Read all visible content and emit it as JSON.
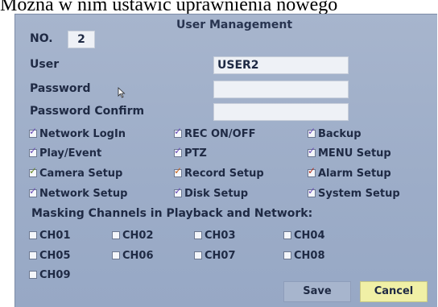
{
  "caption": "Można w nim ustawić uprawnienia nowego",
  "dialog": {
    "title": "User Management",
    "no_label": "NO.",
    "no_value": "2",
    "user_label": "User",
    "user_value": "USER2",
    "password_label": "Password",
    "password_value": "",
    "confirm_label": "Password Confirm",
    "confirm_value": ""
  },
  "permissions": [
    {
      "label": "Network LogIn",
      "checked": true,
      "color": "#6a4bb8"
    },
    {
      "label": "REC ON/OFF",
      "checked": true,
      "color": "#6a4bb8"
    },
    {
      "label": "Backup",
      "checked": true,
      "color": "#6a4bb8"
    },
    {
      "label": "Play/Event",
      "checked": true,
      "color": "#6a4bb8"
    },
    {
      "label": "PTZ",
      "checked": true,
      "color": "#6a4bb8"
    },
    {
      "label": "MENU Setup",
      "checked": true,
      "color": "#6a4bb8"
    },
    {
      "label": "Camera Setup",
      "checked": true,
      "color": "#6a8a25"
    },
    {
      "label": "Record Setup",
      "checked": true,
      "color": "#c8641c"
    },
    {
      "label": "Alarm Setup",
      "checked": true,
      "color": "#b6321e"
    },
    {
      "label": "Network Setup",
      "checked": true,
      "color": "#6a4bb8"
    },
    {
      "label": "Disk Setup",
      "checked": true,
      "color": "#6a4bb8"
    },
    {
      "label": "System Setup",
      "checked": true,
      "color": "#6a4bb8"
    }
  ],
  "masking_label": "Masking Channels in Playback and Network:",
  "channels": [
    {
      "label": "CH01",
      "checked": false
    },
    {
      "label": "CH02",
      "checked": false
    },
    {
      "label": "CH03",
      "checked": false
    },
    {
      "label": "CH04",
      "checked": false
    },
    {
      "label": "CH05",
      "checked": false
    },
    {
      "label": "CH06",
      "checked": false
    },
    {
      "label": "CH07",
      "checked": false
    },
    {
      "label": "CH08",
      "checked": false
    },
    {
      "label": "CH09",
      "checked": false
    }
  ],
  "buttons": {
    "save": "Save",
    "cancel": "Cancel"
  }
}
